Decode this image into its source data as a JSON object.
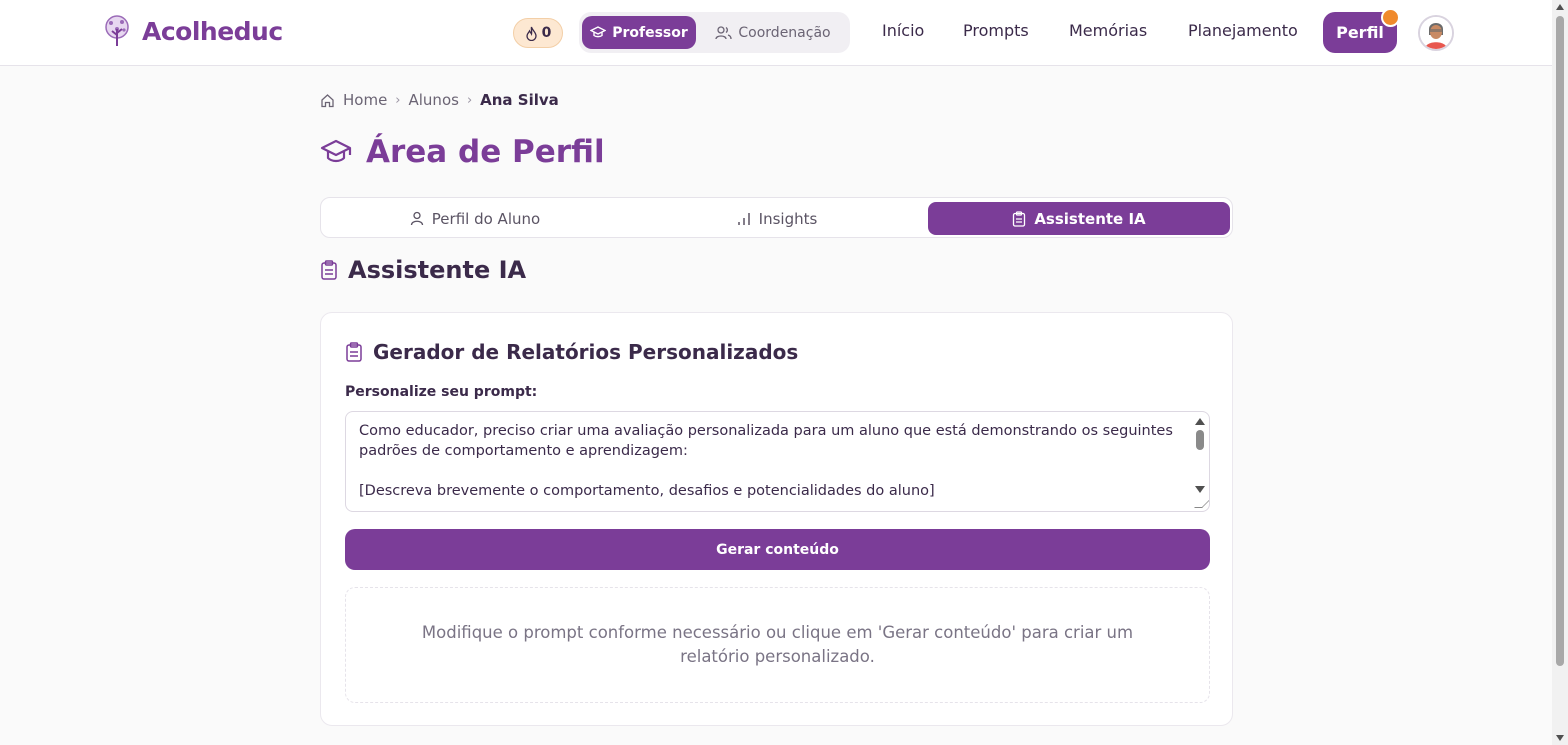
{
  "header": {
    "brand": "Acolheduc",
    "streak_count": "0",
    "roles": {
      "professor": "Professor",
      "coordenacao": "Coordenação"
    },
    "nav": [
      "Início",
      "Prompts",
      "Memórias",
      "Planejamento"
    ],
    "profile_button": "Perfil"
  },
  "breadcrumb": {
    "home": "Home",
    "alunos": "Alunos",
    "current": "Ana Silva"
  },
  "page": {
    "title": "Área de Perfil"
  },
  "tabs": [
    {
      "label": "Perfil do Aluno",
      "icon": "user-icon"
    },
    {
      "label": "Insights",
      "icon": "bar-chart-icon"
    },
    {
      "label": "Assistente IA",
      "icon": "clipboard-icon",
      "active": true
    }
  ],
  "section": {
    "title": "Assistente IA"
  },
  "generator": {
    "title": "Gerador de Relatórios Personalizados",
    "prompt_label": "Personalize seu prompt:",
    "prompt_line1": "Como educador, preciso criar uma avaliação personalizada para um aluno que está demonstrando os seguintes padrões de comportamento e aprendizagem:",
    "prompt_line2": "[Descreva brevemente o comportamento, desafios e potencialidades do aluno]",
    "generate_label": "Gerar conteúdo",
    "placeholder_result": "Modifique o prompt conforme necessário ou clique em 'Gerar conteúdo' para criar um relatório personalizado."
  },
  "colors": {
    "accent": "#7b3d98",
    "streak_bg": "#fde8d2",
    "badge": "#f08a2c"
  }
}
